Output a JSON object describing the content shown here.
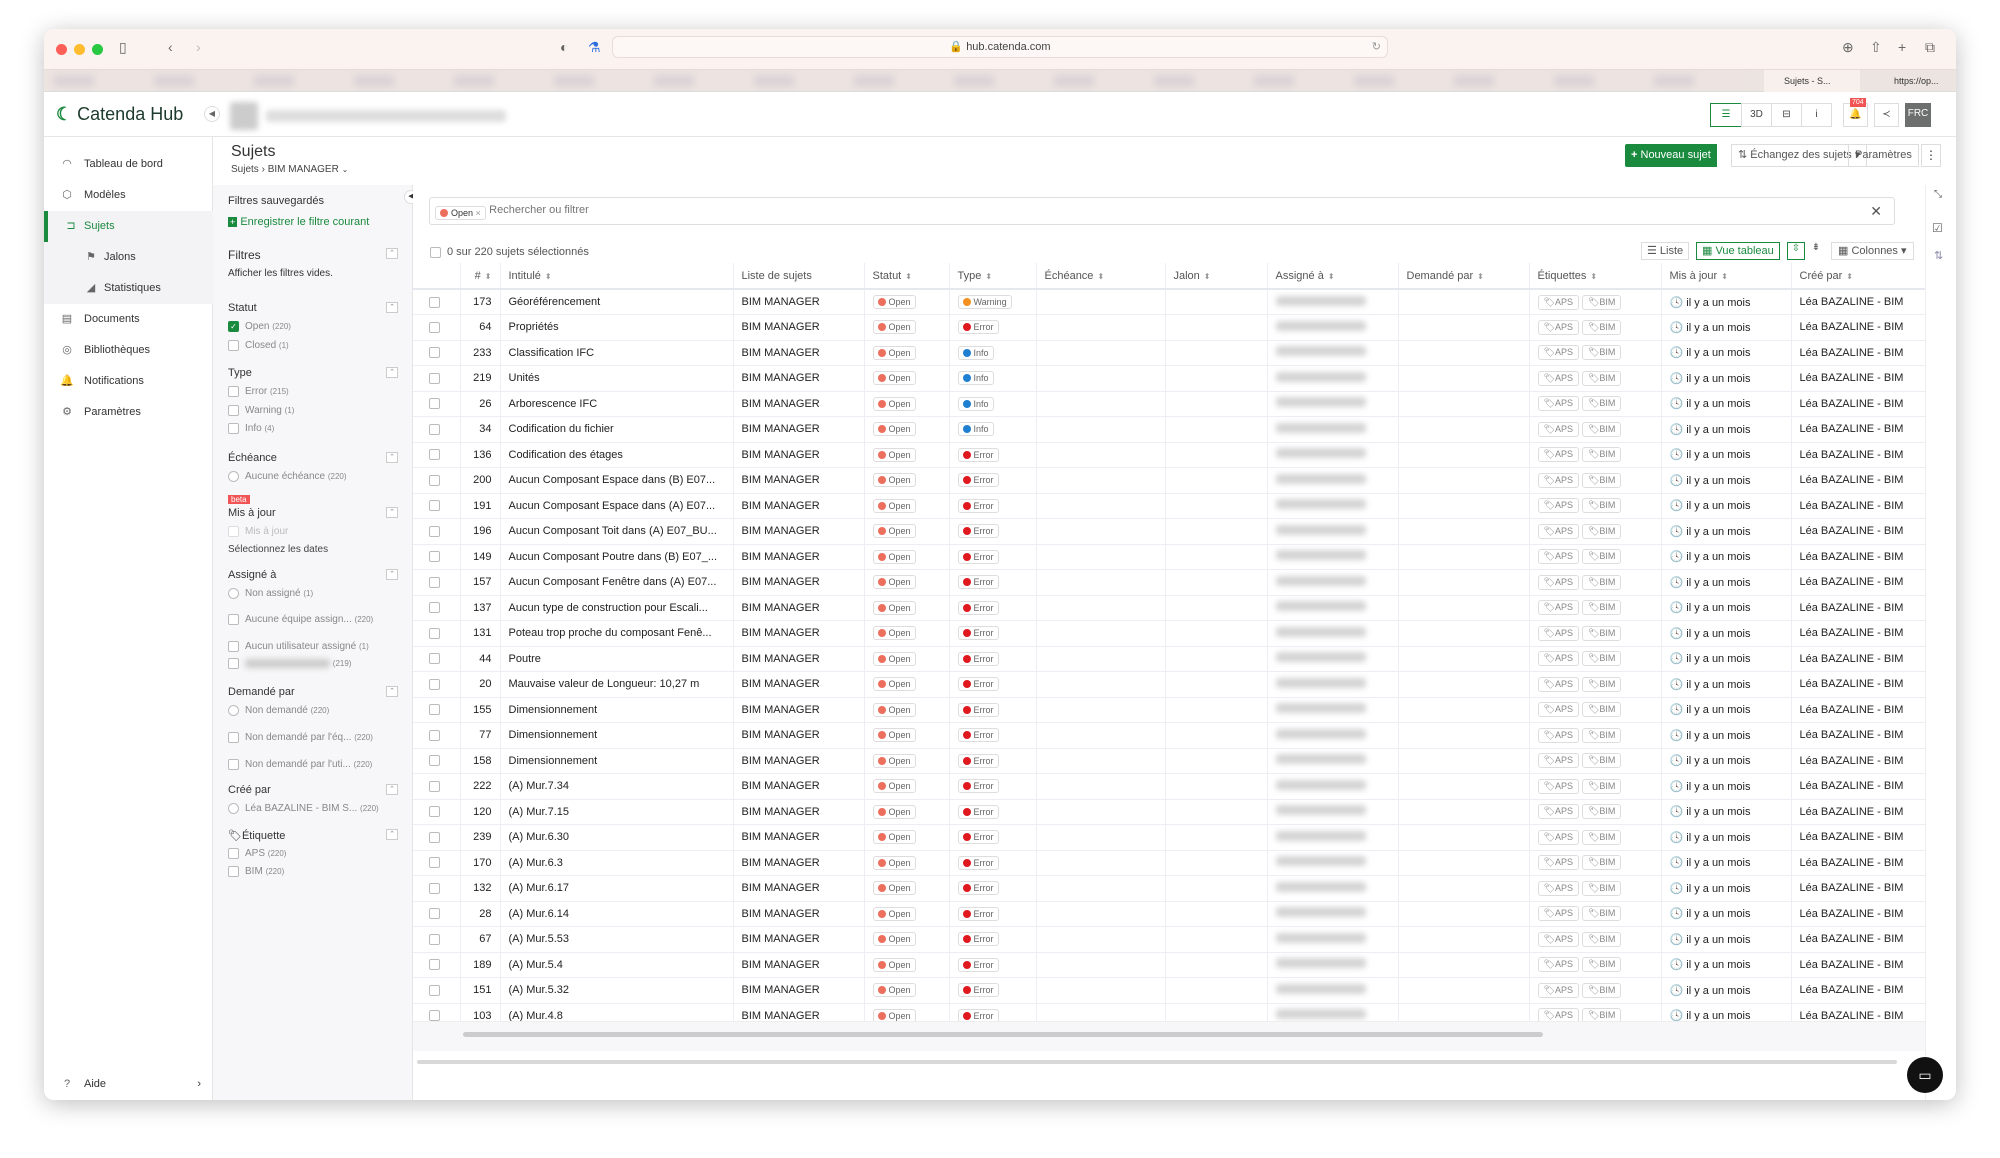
{
  "browser": {
    "url": "hub.catenda.com",
    "tabs": [
      "Sujets - S...",
      "https://op..."
    ]
  },
  "app": {
    "logo": "Catenda Hub",
    "notif_count": "704",
    "avatar": "FRC",
    "view_buttons": [
      "3D",
      "i"
    ]
  },
  "sidebar": {
    "items": [
      {
        "label": "Tableau de bord",
        "icon": "dashboard-icon"
      },
      {
        "label": "Modèles",
        "icon": "cube-icon"
      },
      {
        "label": "Sujets",
        "icon": "topics-icon"
      },
      {
        "label": "Jalons",
        "icon": "flag-icon"
      },
      {
        "label": "Statistiques",
        "icon": "chart-icon"
      },
      {
        "label": "Documents",
        "icon": "archive-icon"
      },
      {
        "label": "Bibliothèques",
        "icon": "library-icon"
      },
      {
        "label": "Notifications",
        "icon": "bell-icon"
      },
      {
        "label": "Paramètres",
        "icon": "gear-icon"
      }
    ],
    "help": "Aide"
  },
  "page": {
    "title": "Sujets",
    "breadcrumb": [
      "Sujets",
      "BIM MANAGER"
    ],
    "new_btn": "Nouveau sujet",
    "exchange_btn": "Échangez des sujets",
    "settings_btn": "Paramètres"
  },
  "filters": {
    "saved_title": "Filtres sauvegardés",
    "save_current": "Enregistrer le filtre courant",
    "title": "Filtres",
    "show_empty": "Afficher les filtres vides.",
    "statut": {
      "title": "Statut",
      "options": [
        {
          "label": "Open",
          "count": "(220)",
          "checked": true
        },
        {
          "label": "Closed",
          "count": "(1)"
        }
      ]
    },
    "type": {
      "title": "Type",
      "options": [
        {
          "label": "Error",
          "count": "(215)"
        },
        {
          "label": "Warning",
          "count": "(1)"
        },
        {
          "label": "Info",
          "count": "(4)"
        }
      ]
    },
    "echeance": {
      "title": "Échéance",
      "options": [
        {
          "label": "Aucune échéance",
          "count": "(220)"
        }
      ]
    },
    "mis_a_jour": {
      "beta": "beta",
      "title": "Mis à jour",
      "option": "Mis à jour",
      "select_dates": "Sélectionnez les dates"
    },
    "assigne": {
      "title": "Assigné à",
      "options": [
        {
          "label": "Non assigné",
          "count": "(1)"
        },
        {
          "label": "Aucune équipe assign...",
          "count": "(220)"
        },
        {
          "label": "Aucun utilisateur assigné",
          "count": "(1)"
        },
        {
          "label": "",
          "count": "(219)"
        }
      ]
    },
    "demande": {
      "title": "Demandé par",
      "options": [
        {
          "label": "Non demandé",
          "count": "(220)"
        },
        {
          "label": "Non demandé par l'éq...",
          "count": "(220)"
        },
        {
          "label": "Non demandé par l'uti...",
          "count": "(220)"
        }
      ]
    },
    "cree": {
      "title": "Créé par",
      "options": [
        {
          "label": "Léa BAZALINE - BIM S...",
          "count": "(220)"
        }
      ]
    },
    "etiquette": {
      "title": "Étiquette",
      "options": [
        {
          "label": "APS",
          "count": "(220)"
        },
        {
          "label": "BIM",
          "count": "(220)"
        }
      ]
    }
  },
  "search": {
    "chip": "Open",
    "placeholder": "Rechercher ou filtrer"
  },
  "selection": "0 sur 220 sujets sélectionnés",
  "views": {
    "list": "Liste",
    "table": "Vue tableau",
    "columns": "Colonnes"
  },
  "table": {
    "columns": [
      "#",
      "Intitulé",
      "Liste de sujets",
      "Statut",
      "Type",
      "Échéance",
      "Jalon",
      "Assigné à",
      "Demandé par",
      "Étiquettes",
      "Mis à jour",
      "Créé par"
    ],
    "list": "BIM MANAGER",
    "status": "Open",
    "tags": [
      "APS",
      "BIM"
    ],
    "updated": "il y a un mois",
    "creator": "Léa BAZALINE - BIM",
    "type_colors": {
      "Error": "#e0191f",
      "Warning": "#f39020",
      "Info": "#1f7fd0"
    },
    "status_color": "#ec6f5e",
    "rows": [
      [
        "173",
        "Géoréférencement",
        "Warning"
      ],
      [
        "64",
        "Propriétés",
        "Error"
      ],
      [
        "233",
        "Classification IFC",
        "Info"
      ],
      [
        "219",
        "Unités",
        "Info"
      ],
      [
        "26",
        "Arborescence IFC",
        "Info"
      ],
      [
        "34",
        "Codification du fichier",
        "Info"
      ],
      [
        "136",
        "Codification des étages",
        "Error"
      ],
      [
        "200",
        "Aucun Composant Espace dans (B) E07...",
        "Error"
      ],
      [
        "191",
        "Aucun Composant Espace dans (A) E07...",
        "Error"
      ],
      [
        "196",
        "Aucun Composant Toit dans (A) E07_BU...",
        "Error"
      ],
      [
        "149",
        "Aucun Composant Poutre dans (B) E07_...",
        "Error"
      ],
      [
        "157",
        "Aucun Composant Fenêtre dans (A) E07...",
        "Error"
      ],
      [
        "137",
        "Aucun type de construction pour Escali...",
        "Error"
      ],
      [
        "131",
        "Poteau trop proche du composant Fenê...",
        "Error"
      ],
      [
        "44",
        "Poutre",
        "Error"
      ],
      [
        "20",
        "Mauvaise valeur de Longueur: 10,27 m",
        "Error"
      ],
      [
        "155",
        "Dimensionnement",
        "Error"
      ],
      [
        "77",
        "Dimensionnement",
        "Error"
      ],
      [
        "158",
        "Dimensionnement",
        "Error"
      ],
      [
        "222",
        "(A) Mur.7.34",
        "Error"
      ],
      [
        "120",
        "(A) Mur.7.15",
        "Error"
      ],
      [
        "239",
        "(A) Mur.6.30",
        "Error"
      ],
      [
        "170",
        "(A) Mur.6.3",
        "Error"
      ],
      [
        "132",
        "(A) Mur.6.17",
        "Error"
      ],
      [
        "28",
        "(A) Mur.6.14",
        "Error"
      ],
      [
        "67",
        "(A) Mur.5.53",
        "Error"
      ],
      [
        "189",
        "(A) Mur.5.4",
        "Error"
      ],
      [
        "151",
        "(A) Mur.5.32",
        "Error"
      ],
      [
        "103",
        "(A) Mur.4.8",
        "Error"
      ]
    ]
  }
}
